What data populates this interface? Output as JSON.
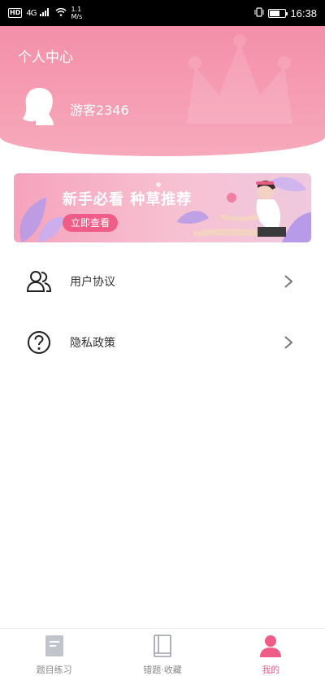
{
  "status_bar": {
    "hd": "HD",
    "network": "4G",
    "speed_top": "1.1",
    "speed_bottom": "M/s",
    "time": "16:38"
  },
  "header": {
    "title": "个人中心",
    "username": "游客2346"
  },
  "banner": {
    "title": "新手必看 种草推荐",
    "button_label": "立即查看"
  },
  "menu": {
    "items": [
      {
        "label": "用户协议",
        "icon": "users-icon"
      },
      {
        "label": "隐私政策",
        "icon": "question-icon"
      }
    ]
  },
  "bottom_nav": {
    "items": [
      {
        "label": "题目练习",
        "icon": "document-icon",
        "active": false
      },
      {
        "label": "错题·收藏",
        "icon": "book-icon",
        "active": false
      },
      {
        "label": "我的",
        "icon": "person-icon",
        "active": true
      }
    ]
  },
  "colors": {
    "header_pink": "#f48fa9",
    "accent": "#ef5c87",
    "inactive_icon": "#c0c4cc"
  }
}
